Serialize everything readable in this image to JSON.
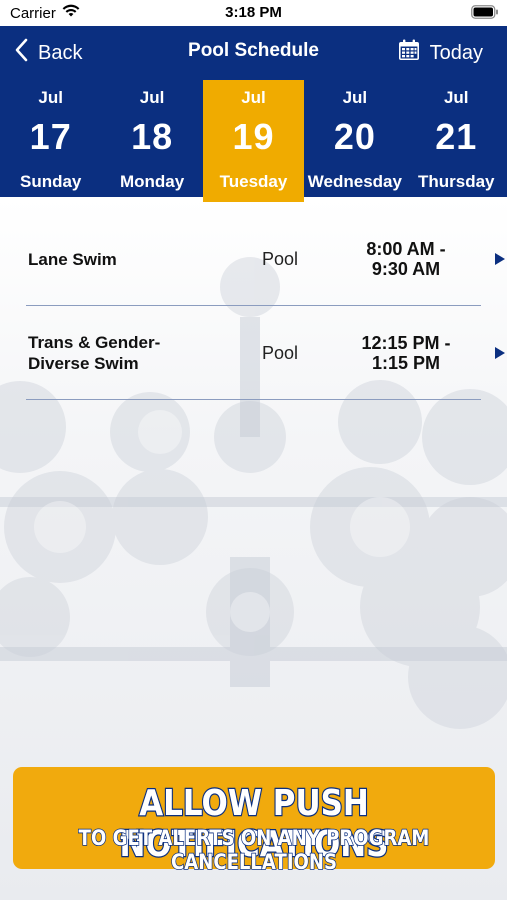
{
  "status_bar": {
    "carrier": "Carrier",
    "time": "3:18 PM"
  },
  "nav": {
    "back_label": "Back",
    "title": "Pool Schedule",
    "today_label": "Today"
  },
  "days": [
    {
      "month": "Jul",
      "date": "17",
      "weekday": "Sunday",
      "selected": false
    },
    {
      "month": "Jul",
      "date": "18",
      "weekday": "Monday",
      "selected": false
    },
    {
      "month": "Jul",
      "date": "19",
      "weekday": "Tuesday",
      "selected": true
    },
    {
      "month": "Jul",
      "date": "20",
      "weekday": "Wednesday",
      "selected": false
    },
    {
      "month": "Jul",
      "date": "21",
      "weekday": "Thursday",
      "selected": false
    }
  ],
  "schedule": [
    {
      "name": "Lane Swim",
      "location": "Pool",
      "time_start": "8:00 AM -",
      "time_end": "9:30 AM"
    },
    {
      "name": "Trans & Gender-Diverse Swim",
      "location": "Pool",
      "time_start": "12:15 PM -",
      "time_end": "1:15 PM"
    }
  ],
  "banner": {
    "title": "ALLOW PUSH NOTIFICATIONS",
    "subtitle": "TO GET ALERTS ON ANY PROGRAM CANCELLATIONS"
  },
  "colors": {
    "primary": "#0b2f80",
    "accent": "#f0ab00",
    "divider": "#8b9cbf"
  },
  "icons": {
    "back": "chevron-left-icon",
    "today": "calendar-icon",
    "row_arrow": "triangle-right-icon",
    "wifi": "wifi-icon",
    "battery": "battery-icon"
  }
}
